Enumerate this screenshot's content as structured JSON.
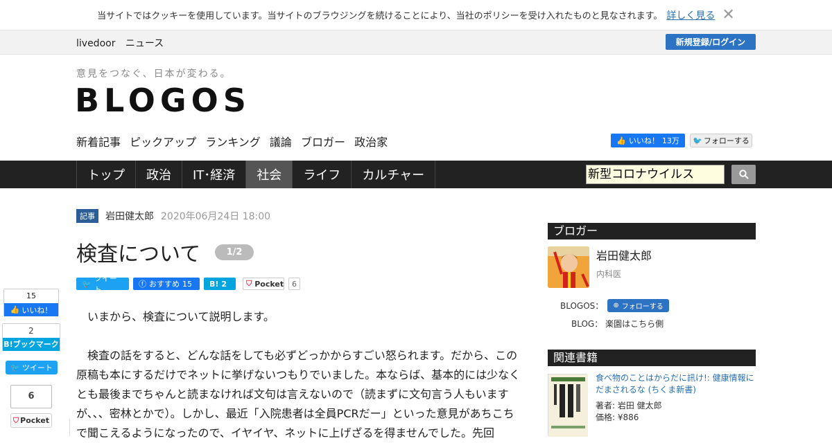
{
  "cookie_bar": {
    "text": "当サイトではクッキーを使用しています。当サイトのブラウジングを続けることにより、当社のポリシーを受け入れたものと見なされます。",
    "link": "詳しく見る",
    "close_icon": "close-icon"
  },
  "topbar": {
    "livedoor": "livedoor",
    "news": "ニュース",
    "login_label": "新規登録/ログイン"
  },
  "header": {
    "tagline": "意見をつなぐ、日本が変わる。",
    "logo": "BLOGOS",
    "subnav": [
      "新着記事",
      "ピックアップ",
      "ランキング",
      "議論",
      "ブロガー",
      "政治家"
    ],
    "fb_like": "いいね！",
    "fb_count": "13万",
    "tw_follow": "フォローする"
  },
  "mainnav": {
    "items": [
      "トップ",
      "政治",
      "IT･経済",
      "社会",
      "ライフ",
      "カルチャー"
    ],
    "active": "社会",
    "search_value": "新型コロナウイルス"
  },
  "article": {
    "badge": "記事",
    "author": "岩田健太郎",
    "date": "2020年06月24日 18:00",
    "title": "検査について",
    "page": "1/2",
    "share": {
      "tweet": "ツイート",
      "fb": "おすすめ",
      "fb_count": "15",
      "hatena": "B!",
      "hatena_count": "2",
      "pocket": "Pocket",
      "pocket_count": "6"
    },
    "paragraphs": [
      "いまから、検査について説明します。",
      "検査の話をすると、どんな話をしても必ずどっかからすごい怒られます。だから、この原稿も本にするだけでネットに挙げないつもりでいました。本ならば、基本的には少なくとも最後までちゃんと読まなければ文句は言えないので（読まずに文句言う人もいますが、、、密林とかで）。しかし、最近「入院患者は全員PCRだー」といった意見があちこちで聞こえるようになったので、イヤイヤ、ネットに上げざるを得ませんでした。先回"
    ]
  },
  "floating_share": {
    "fb_count": "15",
    "fb_label": "いいね！",
    "hatena_count": "2",
    "hatena_label": "B!ブックマーク",
    "tweet_label": "ツイート",
    "pocket_count": "6",
    "pocket_label": "Pocket"
  },
  "sidebar": {
    "blogger_heading": "ブロガー",
    "blogger_name": "岩田健太郎",
    "blogger_job": "内科医",
    "blogos_label": "BLOGOS：",
    "follow_label": "フォローする",
    "blog_label": "BLOG：",
    "blog_name": "楽園はこちら側",
    "books_heading": "関連書籍",
    "book_title": "食べ物のことはからだに訊け!: 健康情報にだまされるな (ちくま新書)",
    "book_author": "著者: 岩田 健太郎",
    "book_price": "価格: ¥886"
  }
}
